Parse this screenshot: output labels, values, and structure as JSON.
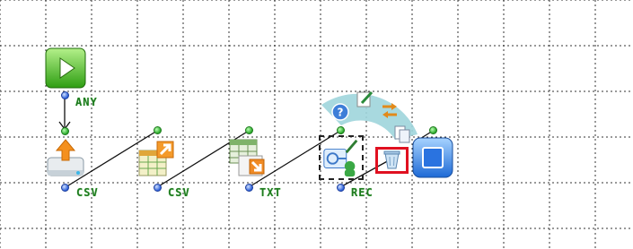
{
  "canvas": {
    "background": "#ffffff",
    "grid_color": "#333333"
  },
  "labels": {
    "any": "ANY",
    "csv_1": "CSV",
    "csv_2": "CSV",
    "txt": "TXT",
    "rec": "REC"
  },
  "nodes": [
    {
      "name": "play-start-node",
      "icon": "play-icon"
    },
    {
      "name": "upload-drive-node",
      "icon": "upload-drive-icon"
    },
    {
      "name": "csv-export-node",
      "icon": "csv-export-icon"
    },
    {
      "name": "csv-to-txt-node",
      "icon": "table-convert-icon"
    },
    {
      "name": "record-node",
      "icon": "record-processor-icon"
    },
    {
      "name": "stop-end-node",
      "icon": "stop-icon"
    }
  ],
  "context_menu": {
    "items": [
      "help-icon",
      "edit-icon",
      "replace-icon",
      "copy-icon",
      "delete-icon"
    ],
    "highlighted": "delete-icon",
    "highlight_color": "#e01020"
  }
}
